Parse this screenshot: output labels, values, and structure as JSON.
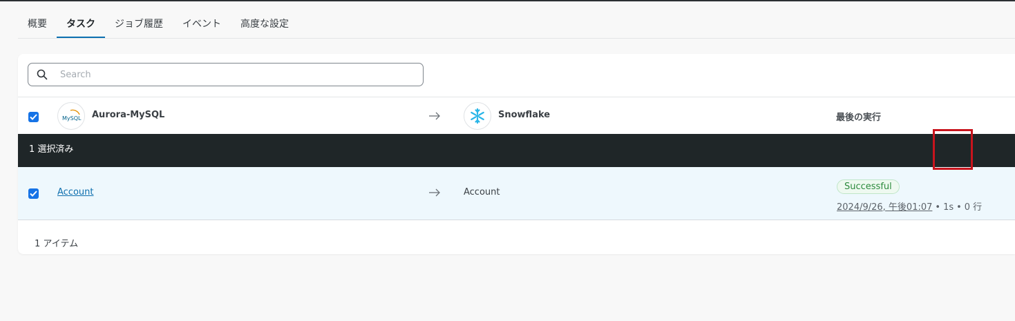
{
  "tabs": [
    {
      "label": "概要",
      "active": false
    },
    {
      "label": "タスク",
      "active": true
    },
    {
      "label": "ジョブ履歴",
      "active": false
    },
    {
      "label": "イベント",
      "active": false
    },
    {
      "label": "高度な設定",
      "active": false
    }
  ],
  "search": {
    "placeholder": "Search",
    "value": ""
  },
  "header": {
    "source_name": "Aurora-MySQL",
    "source_logo_text": "MySQL",
    "destination_name": "Snowflake",
    "last_run_label": "最後の実行"
  },
  "selection": {
    "label": "1 選択済み"
  },
  "rows": [
    {
      "source_table": "Account",
      "destination_table": "Account",
      "status": "Successful",
      "date": "2024/9/26, 午後01:07",
      "duration": "1s",
      "rows": "0 行"
    }
  ],
  "footer": {
    "item_count": "1 アイテム"
  },
  "colors": {
    "accent": "#0b6fb0",
    "checkbox": "#1673e6",
    "selection_bar": "#1f2628",
    "row_selected_bg": "#eef8fd",
    "success_text": "#2c8a3c",
    "highlight_box": "#c8141d",
    "snowflake": "#29b5e8",
    "mysql_orange": "#e48e00",
    "mysql_blue": "#00618a"
  }
}
